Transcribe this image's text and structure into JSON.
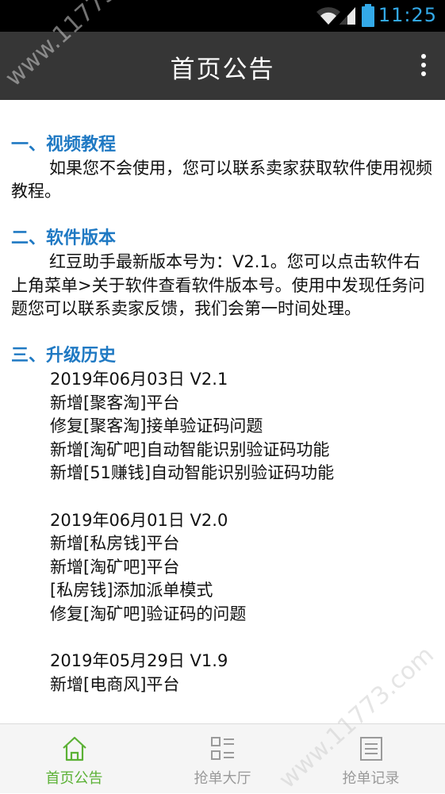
{
  "status_bar": {
    "time": "11:25",
    "icons": [
      "wifi-icon",
      "signal-icon",
      "battery-icon"
    ]
  },
  "app_bar": {
    "title": "首页公告",
    "menu_icon": "more-vert-icon"
  },
  "sections": [
    {
      "heading": "一、视频教程",
      "paragraph": "如果您不会使用，您可以联系卖家获取软件使用视频教程。"
    },
    {
      "heading": "二、软件版本",
      "paragraph": "红豆助手最新版本号为：V2.1。您可以点击软件右上角菜单>关于软件查看软件版本号。使用中发现任务问题您可以联系卖家反馈，我们会第一时间处理。"
    },
    {
      "heading": "三、升级历史",
      "history": [
        {
          "version_line": "2019年06月03日 V2.1",
          "changes": [
            "新增[聚客淘]平台",
            "修复[聚客淘]接单验证码问题",
            "新增[淘矿吧]自动智能识别验证码功能",
            "新增[51赚钱]自动智能识别验证码功能"
          ]
        },
        {
          "version_line": "2019年06月01日 V2.0",
          "changes": [
            "新增[私房钱]平台",
            "新增[淘矿吧]平台",
            "[私房钱]添加派单模式",
            "修复[淘矿吧]验证码的问题"
          ]
        },
        {
          "version_line": "2019年05月29日 V1.9",
          "changes": [
            "新增[电商风]平台"
          ]
        }
      ]
    }
  ],
  "bottom_nav": [
    {
      "label": "首页公告",
      "icon": "home-icon",
      "active": true
    },
    {
      "label": "抢单大厅",
      "icon": "list-grid-icon",
      "active": false
    },
    {
      "label": "抢单记录",
      "icon": "document-icon",
      "active": false
    }
  ],
  "watermark": "www.11773.com",
  "colors": {
    "accent": "#1f79c3",
    "active_tab": "#5bb135",
    "app_bar": "#363636",
    "status_time": "#33a9e8"
  }
}
